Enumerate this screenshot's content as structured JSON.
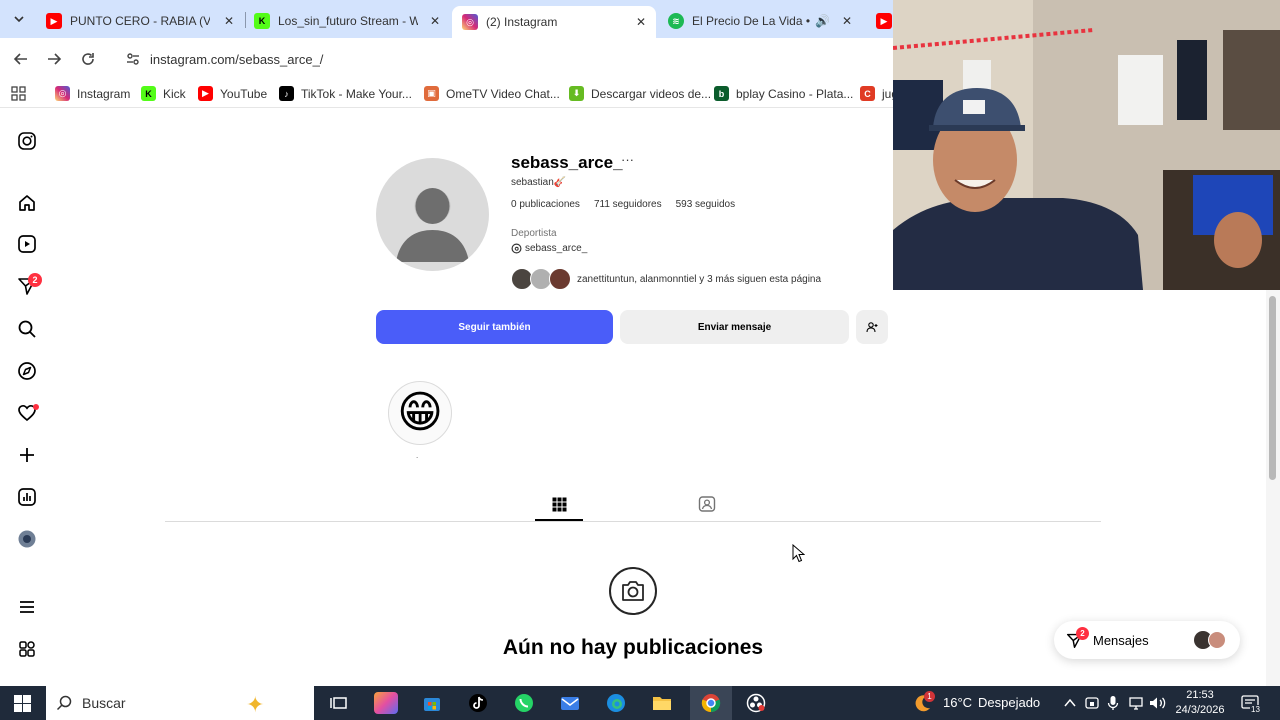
{
  "browser": {
    "tabs": [
      {
        "label": "PUNTO CERO - RABIA (VIDE",
        "active": false,
        "icon": "youtube-icon",
        "color": "#ff0000"
      },
      {
        "label": "Los_sin_futuro Stream - Wat",
        "active": false,
        "icon": "kick-icon",
        "color": "#53fc18"
      },
      {
        "label": "(2) Instagram",
        "active": true,
        "icon": "instagram-icon",
        "color": "#d62976"
      },
      {
        "label": "El Precio De La Vida • Pa",
        "active": false,
        "icon": "spotify-icon",
        "color": "#1db954"
      }
    ],
    "url": "instagram.com/sebass_arce_/",
    "bookmarks": [
      {
        "label": "Instagram",
        "icon": "instagram-icon",
        "color": "#d62976"
      },
      {
        "label": "Kick",
        "icon": "kick-icon",
        "color": "#53fc18"
      },
      {
        "label": "YouTube",
        "icon": "youtube-icon",
        "color": "#ff0000"
      },
      {
        "label": "TikTok - Make Your...",
        "icon": "tiktok-icon",
        "color": "#000000"
      },
      {
        "label": "OmeTV Video Chat...",
        "icon": "ometv-icon",
        "color": "#e06b3c"
      },
      {
        "label": "Descargar videos de...",
        "icon": "download-icon",
        "color": "#66bb22"
      },
      {
        "label": "bplay Casino - Plata...",
        "icon": "bplay-icon",
        "color": "#0b5c2c"
      },
      {
        "label": "jug",
        "icon": "bookmark-icon",
        "color": "#e03b24"
      }
    ]
  },
  "profile": {
    "username": "sebass_arce_",
    "full_name": "sebastian🎸",
    "posts": "0 publicaciones",
    "followers": "711 seguidores",
    "following": "593 seguidos",
    "category": "Deportista",
    "threads_handle": "sebass_arce_",
    "followed_by": "zanettituntun, alanmonntiel y 3 más siguen esta página",
    "follow_button": "Seguir también",
    "message_button": "Enviar mensaje",
    "highlight_emoji": "😁",
    "highlight_label": "."
  },
  "empty_state": {
    "title": "Aún no hay publicaciones"
  },
  "messages": {
    "label": "Mensajes",
    "badge": "2"
  },
  "rail": {
    "notifications_badge": "2"
  },
  "taskbar": {
    "search_placeholder": "Buscar",
    "weather": "16°C",
    "weather_status": "Despejado",
    "weather_badge": "1",
    "time": "21:53",
    "date": "24/3/2026",
    "notification_count": "13"
  },
  "colors": {
    "follow_blue": "#4a5df9",
    "badge_red": "#ff3040",
    "taskbar": "#1f2a3a",
    "tabstrip": "#d3e3fd"
  }
}
